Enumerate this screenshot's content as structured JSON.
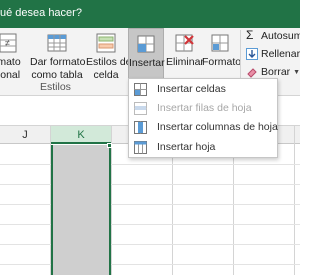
{
  "tell_me": {
    "text": "ué desea hacer?"
  },
  "ribbon": {
    "buttons": [
      {
        "name": "conditional-format",
        "line1": "mato",
        "line2": "ional"
      },
      {
        "name": "format-as-table",
        "line1": "Dar formato",
        "line2": "como tabla"
      },
      {
        "name": "cell-styles",
        "line1": "Estilos de",
        "line2": "celda"
      },
      {
        "name": "insert",
        "line1": "Insertar"
      },
      {
        "name": "delete",
        "line1": "Eliminar"
      },
      {
        "name": "format",
        "line1": "Formato"
      }
    ],
    "group_label": "Estilos",
    "right": {
      "autosum": "Autosuma",
      "fill": "Rellenar",
      "clear": "Borrar"
    }
  },
  "menu": {
    "items": [
      {
        "label": "Insertar celdas",
        "underline": "c",
        "rest": "eldas",
        "pre": "Insertar ",
        "enabled": true
      },
      {
        "label": "Insertar filas de hoja",
        "enabled": false
      },
      {
        "label": "Insertar columnas de hoja",
        "enabled": true
      },
      {
        "label": "Insertar hoja",
        "enabled": true
      }
    ]
  },
  "sheet": {
    "columns": [
      "J",
      "K"
    ]
  },
  "colors": {
    "accent": "#217346",
    "ribbon_bg": "#f3f3f3",
    "selection": "#cfcfcf"
  }
}
